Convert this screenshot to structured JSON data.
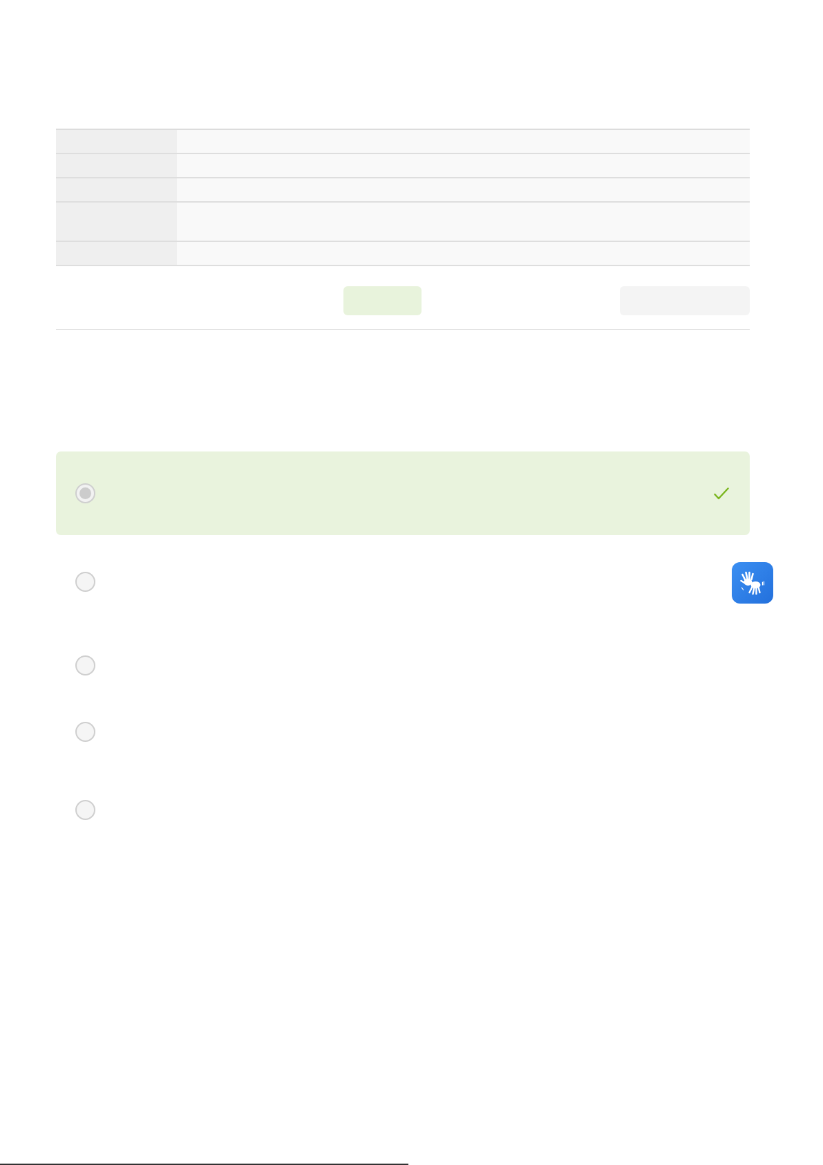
{
  "table": {
    "rows": [
      {
        "kind": "single"
      },
      {
        "kind": "single"
      },
      {
        "kind": "single"
      },
      {
        "kind": "double"
      },
      {
        "kind": "single"
      }
    ]
  },
  "actions": [
    {
      "kind": "primary"
    },
    {
      "kind": "secondary"
    }
  ],
  "options": [
    {
      "selected": true,
      "correct": true
    },
    {
      "selected": false,
      "correct": false
    },
    {
      "selected": false,
      "correct": false
    },
    {
      "selected": false,
      "correct": false
    },
    {
      "selected": false,
      "correct": false
    }
  ]
}
